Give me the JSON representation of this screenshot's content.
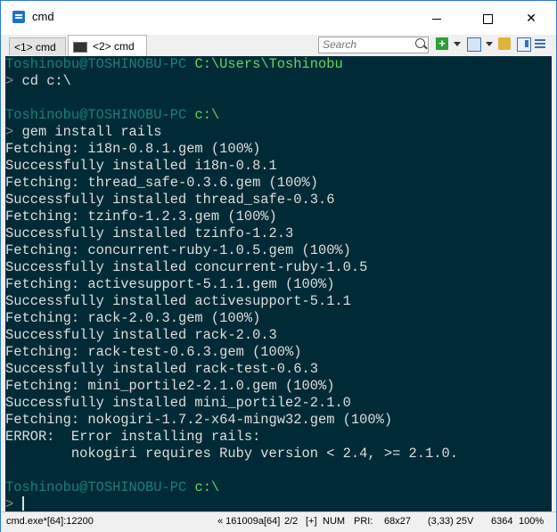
{
  "window": {
    "title": "cmd"
  },
  "tabs": [
    {
      "label": "<1> cmd"
    },
    {
      "label": "<2> cmd"
    }
  ],
  "toolbar": {
    "search_placeholder": "Search"
  },
  "console": {
    "lines": [
      {
        "user": "Toshinobu@TOSHINOBU-PC",
        "path": "C:\\Users\\Toshinobu"
      },
      {
        "arrow": ">",
        "text": " cd c:\\"
      },
      {
        "text": ""
      },
      {
        "user": "Toshinobu@TOSHINOBU-PC",
        "path": "c:\\"
      },
      {
        "arrow": ">",
        "text": " gem install rails"
      },
      {
        "text": "Fetching: i18n-0.8.1.gem (100%)"
      },
      {
        "text": "Successfully installed i18n-0.8.1"
      },
      {
        "text": "Fetching: thread_safe-0.3.6.gem (100%)"
      },
      {
        "text": "Successfully installed thread_safe-0.3.6"
      },
      {
        "text": "Fetching: tzinfo-1.2.3.gem (100%)"
      },
      {
        "text": "Successfully installed tzinfo-1.2.3"
      },
      {
        "text": "Fetching: concurrent-ruby-1.0.5.gem (100%)"
      },
      {
        "text": "Successfully installed concurrent-ruby-1.0.5"
      },
      {
        "text": "Fetching: activesupport-5.1.1.gem (100%)"
      },
      {
        "text": "Successfully installed activesupport-5.1.1"
      },
      {
        "text": "Fetching: rack-2.0.3.gem (100%)"
      },
      {
        "text": "Successfully installed rack-2.0.3"
      },
      {
        "text": "Fetching: rack-test-0.6.3.gem (100%)"
      },
      {
        "text": "Successfully installed rack-test-0.6.3"
      },
      {
        "text": "Fetching: mini_portile2-2.1.0.gem (100%)"
      },
      {
        "text": "Successfully installed mini_portile2-2.1.0"
      },
      {
        "text": "Fetching: nokogiri-1.7.2-x64-mingw32.gem (100%)"
      },
      {
        "text": "ERROR:  Error installing rails:"
      },
      {
        "text": "        nokogiri requires Ruby version < 2.4, >= 2.1.0."
      },
      {
        "text": ""
      },
      {
        "user": "Toshinobu@TOSHINOBU-PC",
        "path": "c:\\"
      },
      {
        "arrow": ">",
        "text": " ",
        "cursor": true
      }
    ]
  },
  "statusbar": {
    "process": "cmd.exe*[64]:12200",
    "handle": "« 161009a[64]",
    "pages": "2/2",
    "plus": "[+]",
    "num": "NUM",
    "pri": "PRI:",
    "size": "68x27",
    "coords": "(3,33) 25V",
    "pid": "6364",
    "zoom": "100%"
  },
  "colors": {
    "console_bg": "#002b36",
    "console_text": "#dddddd",
    "prompt_user": "#1b7f76",
    "prompt_path": "#5fd75f"
  }
}
